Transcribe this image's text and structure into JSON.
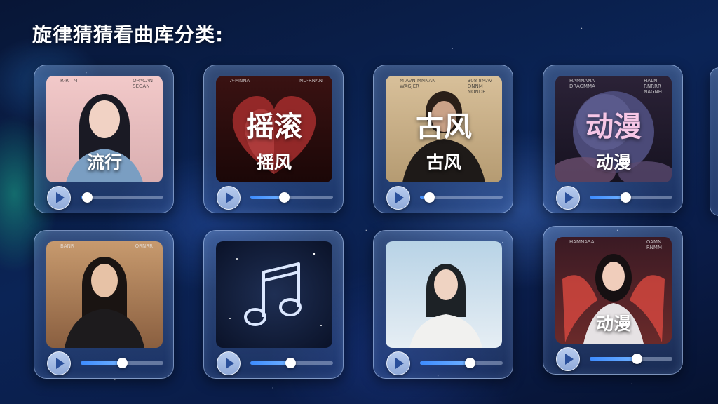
{
  "page": {
    "title": "旋律猜猜看曲库分类:"
  },
  "cards": [
    {
      "cover_label": "流行",
      "cover_big": "",
      "mini_left": "R·R   M",
      "mini_right": "OPACAN\nSEGAN",
      "progress": 0.08,
      "play_icon": "play-icon"
    },
    {
      "cover_label": "摇风",
      "cover_big": "摇滚",
      "mini_left": "A·MNNA\n",
      "mini_right": "ND·RNAN\n",
      "progress": 0.41,
      "play_icon": "play-icon"
    },
    {
      "cover_label": "古风",
      "cover_big": "古风",
      "mini_left": "M AVN MNNAN\nWAGJER",
      "mini_right": "308 8MAV\nQNNM\nNONDE",
      "progress": 0.11,
      "play_icon": "play-icon"
    },
    {
      "cover_label": "动漫",
      "cover_big": "动漫",
      "mini_left": "HAMNANA\nDRAGMMA",
      "mini_right": "HALN\nRNRRR\nNAGNH",
      "progress": 0.43,
      "play_icon": "play-icon"
    },
    {
      "cover_label": "",
      "cover_big": "",
      "mini_left": "BANR",
      "mini_right": "ORNRR",
      "progress": 0.5,
      "play_icon": "play-icon"
    },
    {
      "cover_label": "",
      "cover_big": "",
      "mini_left": "",
      "mini_right": "",
      "progress": 0.48,
      "play_icon": "play-icon"
    },
    {
      "cover_label": "",
      "cover_big": "",
      "mini_left": "",
      "mini_right": "",
      "progress": 0.6,
      "play_icon": "play-icon"
    },
    {
      "cover_label": "动漫",
      "cover_big": "",
      "mini_left": "HAMNASA",
      "mini_right": "OAMN\nRNMM",
      "progress": 0.57,
      "play_icon": "play-icon"
    }
  ],
  "icons": {
    "music_note": "music-note-icon",
    "play": "play-icon"
  },
  "colors": {
    "accent": "#3d8cff",
    "card_border": "#bed7ff",
    "background": "#0b2456"
  }
}
